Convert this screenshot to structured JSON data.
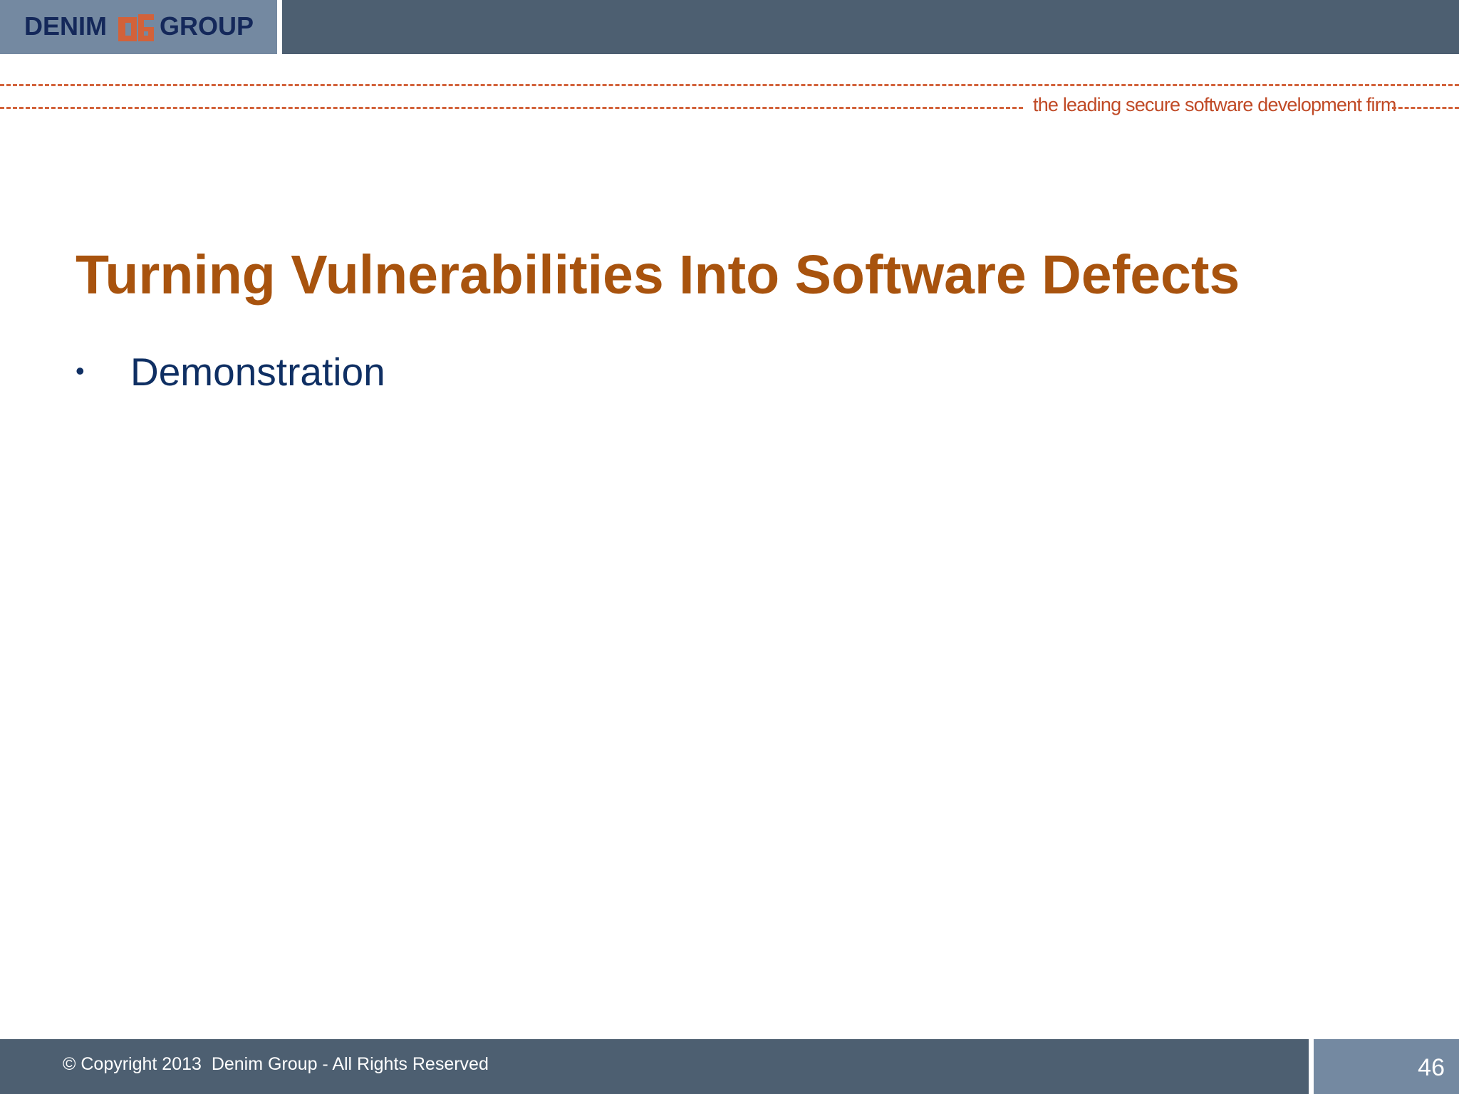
{
  "header": {
    "logo": {
      "left_text": "DENIM",
      "right_text": "GROUP",
      "mark_icon": "dg-monogram-icon"
    },
    "tagline": "the leading secure software development firm"
  },
  "slide": {
    "title": "Turning Vulnerabilities Into Software Defects",
    "bullets": [
      {
        "text": "Demonstration"
      }
    ]
  },
  "footer": {
    "copyright": "© Copyright 2013  Denim Group - All Rights Reserved",
    "page_number": "46"
  },
  "colors": {
    "header_bar": "#4d5f71",
    "logo_box": "#7489a1",
    "logo_text": "#14285a",
    "logo_mark": "#d2623a",
    "dashes": "#d2623a",
    "title": "#a8530e",
    "bullet_text": "#0f2f63",
    "footer_text": "#ffffff"
  }
}
